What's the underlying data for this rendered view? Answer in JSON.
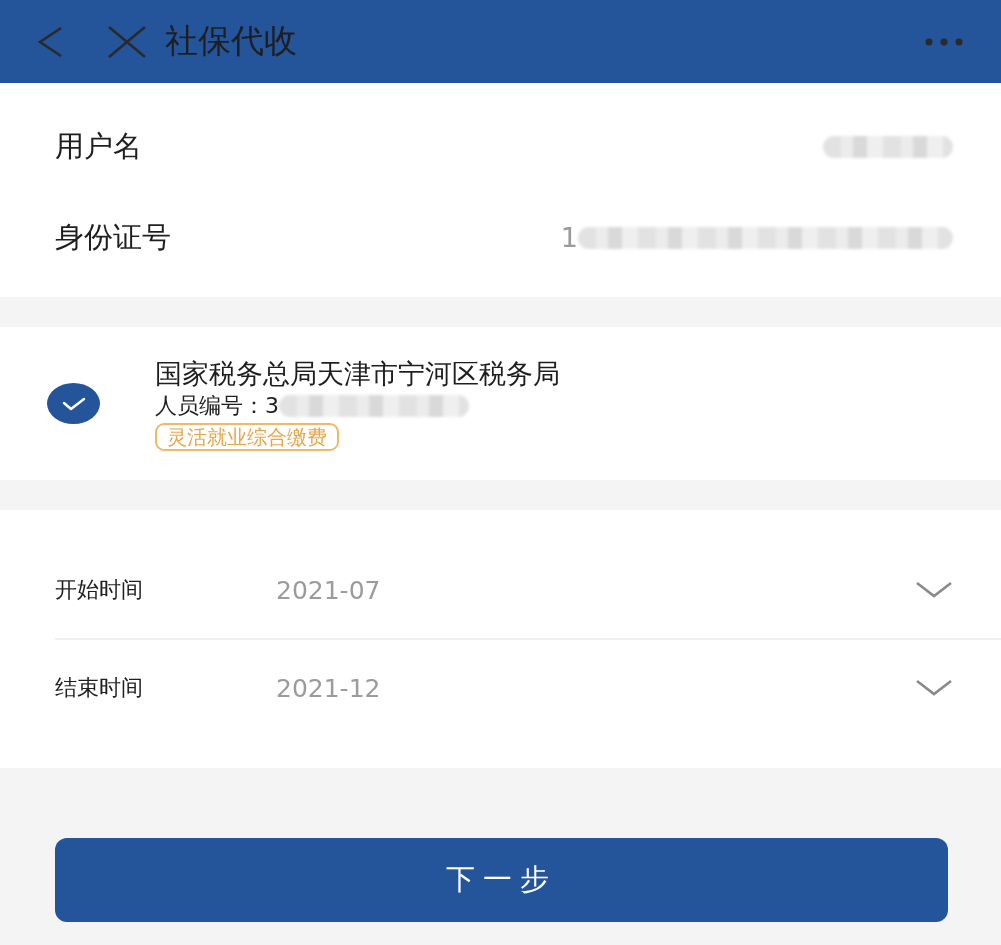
{
  "header": {
    "title": "社保代收"
  },
  "user_info": [
    {
      "label": "用户名",
      "redacted": true
    },
    {
      "label": "身份证号",
      "value": "1",
      "redacted": true
    }
  ],
  "account": {
    "selected": true,
    "office": "国家税务总局天津市宁河区税务局",
    "person_no": "人员编号：3",
    "redacted": true,
    "tag": "灵活就业综合缴费"
  },
  "period": [
    {
      "label": "开始时间",
      "value": "2021-07"
    },
    {
      "label": "结束时间",
      "value": "2021-12"
    }
  ],
  "button": {
    "label": "下一步"
  }
}
